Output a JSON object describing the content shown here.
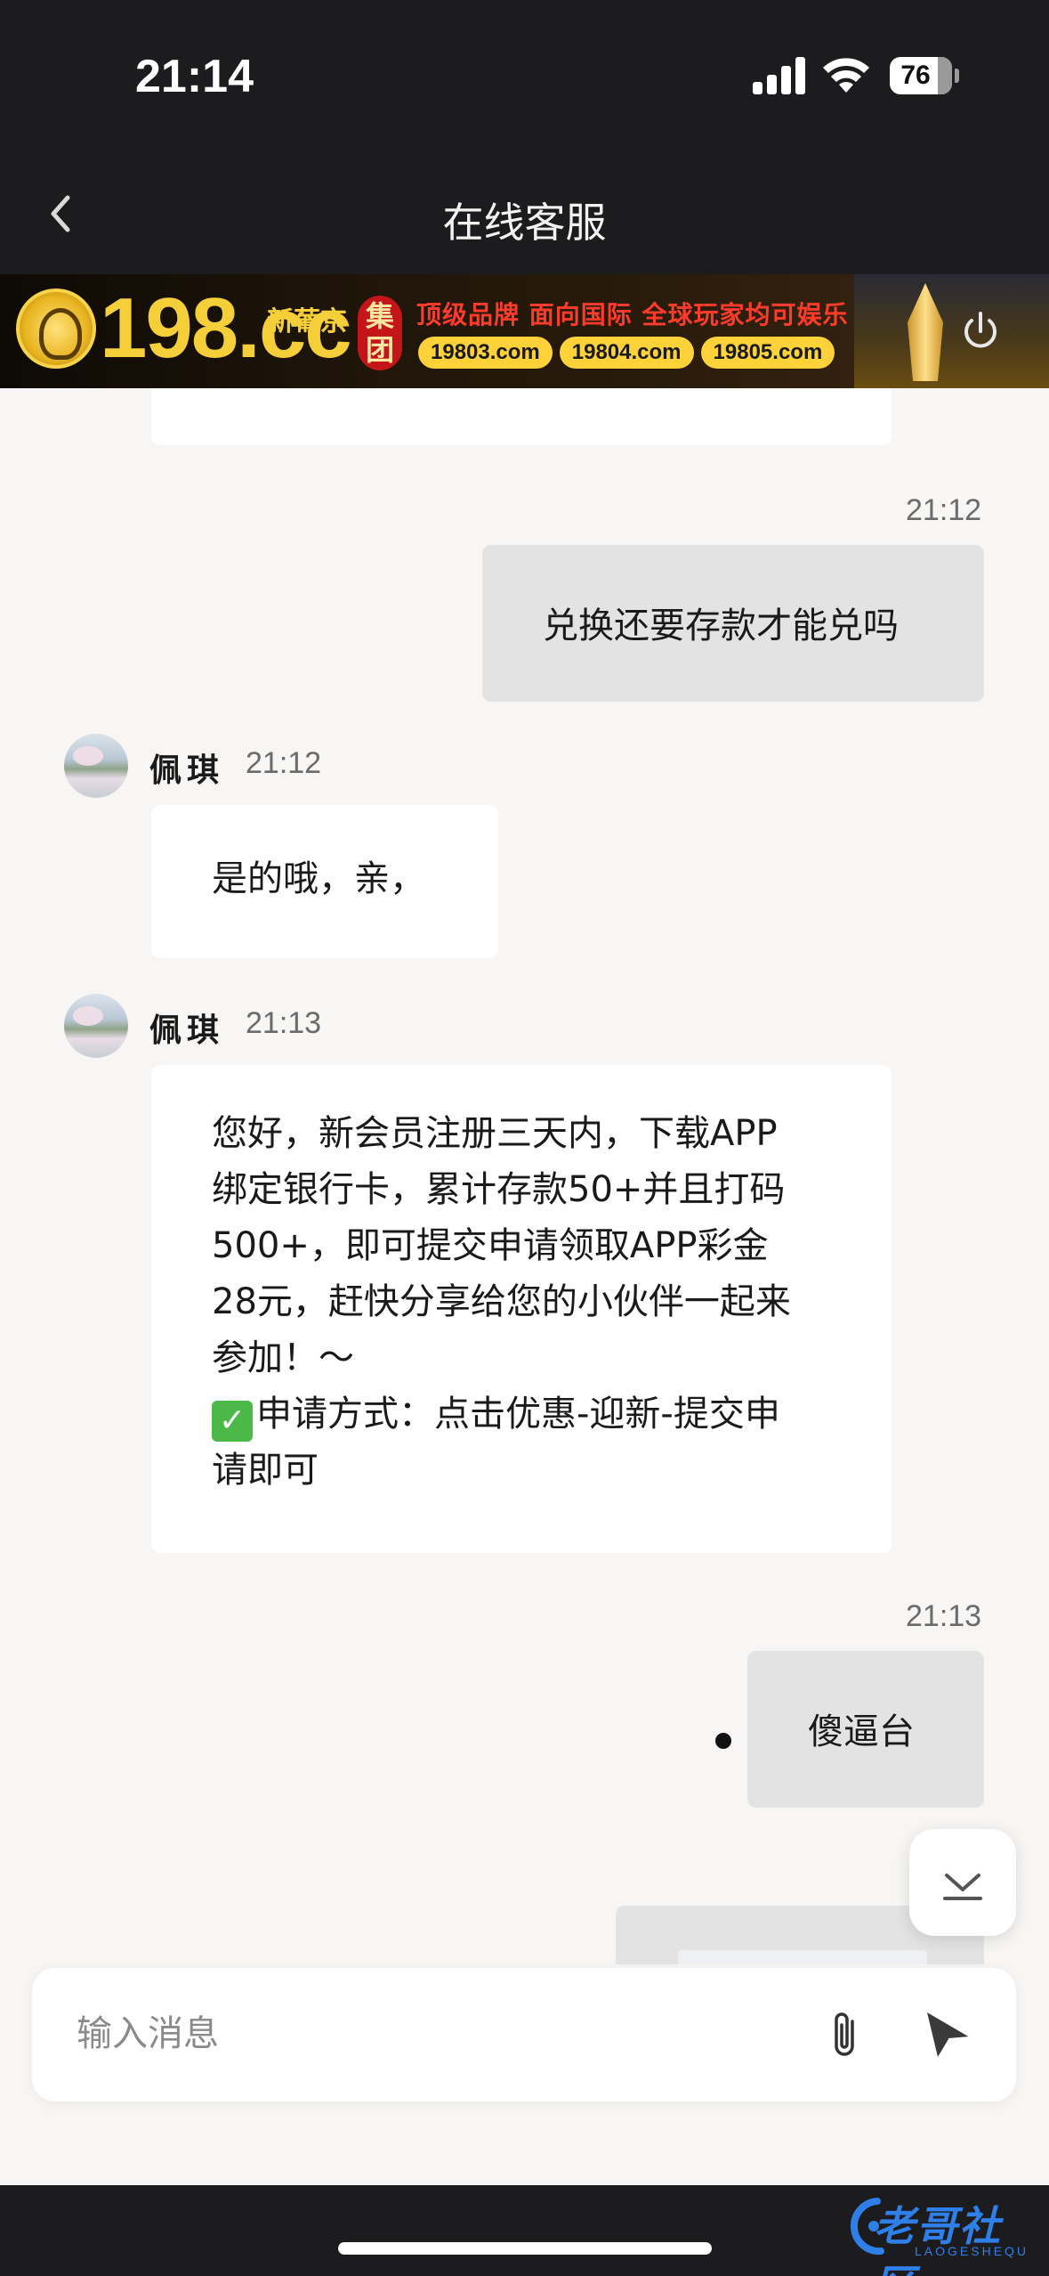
{
  "status_bar": {
    "time": "21:14",
    "battery": "76"
  },
  "nav": {
    "title": "在线客服"
  },
  "banner": {
    "brand": "198.cc",
    "brand_sub": "新葡京",
    "brand_group": "集团",
    "slogan": "顶级品牌 面向国际 全球玩家均可娱乐",
    "domains": [
      "19803.com",
      "19804.com",
      "19805.com"
    ]
  },
  "messages": {
    "m1": {
      "time": "21:12",
      "text": "兑换还要存款才能兑吗"
    },
    "m2": {
      "agent": "佩琪",
      "time": "21:12",
      "text": "是的哦，亲，"
    },
    "m3": {
      "agent": "佩琪",
      "time": "21:13",
      "lines": [
        "您好，新会员注册三天内，下载APP",
        "绑定银行卡，累计存款50+并且打码",
        "500+，即可提交申请领取APP彩金",
        "28元，赶快分享给您的小伙伴一起来",
        "参加！～"
      ],
      "apply_line": "申请方式：点击优惠-迎新-提交申",
      "apply_line2": "请即可"
    },
    "m4": {
      "time": "21:13",
      "text": "傻逼台"
    }
  },
  "input": {
    "placeholder": "输入消息"
  },
  "watermark": {
    "text": "老哥社区",
    "sub": "LAOGESHEQU"
  },
  "colors": {
    "dark": "#1c1c1e",
    "accent": "#f5cf3a",
    "incoming": "#ffffff",
    "outgoing": "#e3e3e3"
  }
}
